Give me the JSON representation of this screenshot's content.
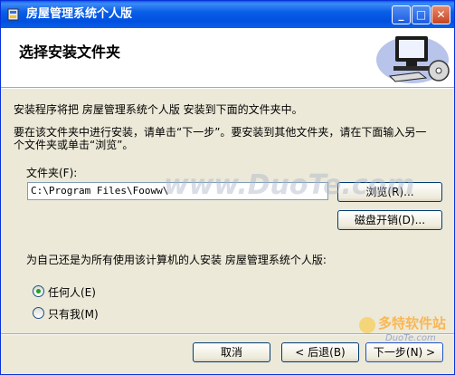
{
  "window": {
    "title": "房屋管理系统个人版",
    "minimize_glyph": "_",
    "maximize_glyph": "□",
    "close_glyph": "✕"
  },
  "header": {
    "title": "选择安装文件夹",
    "graphic_icon": "computer-disk-icon"
  },
  "body": {
    "intro": "安装程序将把 房屋管理系统个人版 安装到下面的文件夹中。",
    "instructions_line1": "要在该文件夹中进行安装，请单击“下一步”。要安装到其他文件夹，请在下面输入另一",
    "instructions_line2": "个文件夹或单击“浏览”。",
    "folder_label": "文件夹(F):",
    "folder_path": "C:\\Program Files\\Fooww\\",
    "browse_button": "浏览(R)...",
    "disk_cost_button": "磁盘开销(D)...",
    "audience_question": "为自己还是为所有使用该计算机的人安装 房屋管理系统个人版:",
    "radio_everyone": "任何人(E)",
    "radio_just_me": "只有我(M)",
    "selected": "everyone"
  },
  "footer": {
    "cancel_button": "取消",
    "back_button": "< 后退(B)",
    "next_button": "下一步(N) >"
  },
  "watermarks": {
    "center": "www.DuoTe.com",
    "corner_top": "多特软件站",
    "corner_bottom": "DuoTe.com"
  },
  "colors": {
    "titlebar": "#0a5fe8",
    "dialog_bg": "#ece9d8",
    "button_border": "#003c74"
  }
}
